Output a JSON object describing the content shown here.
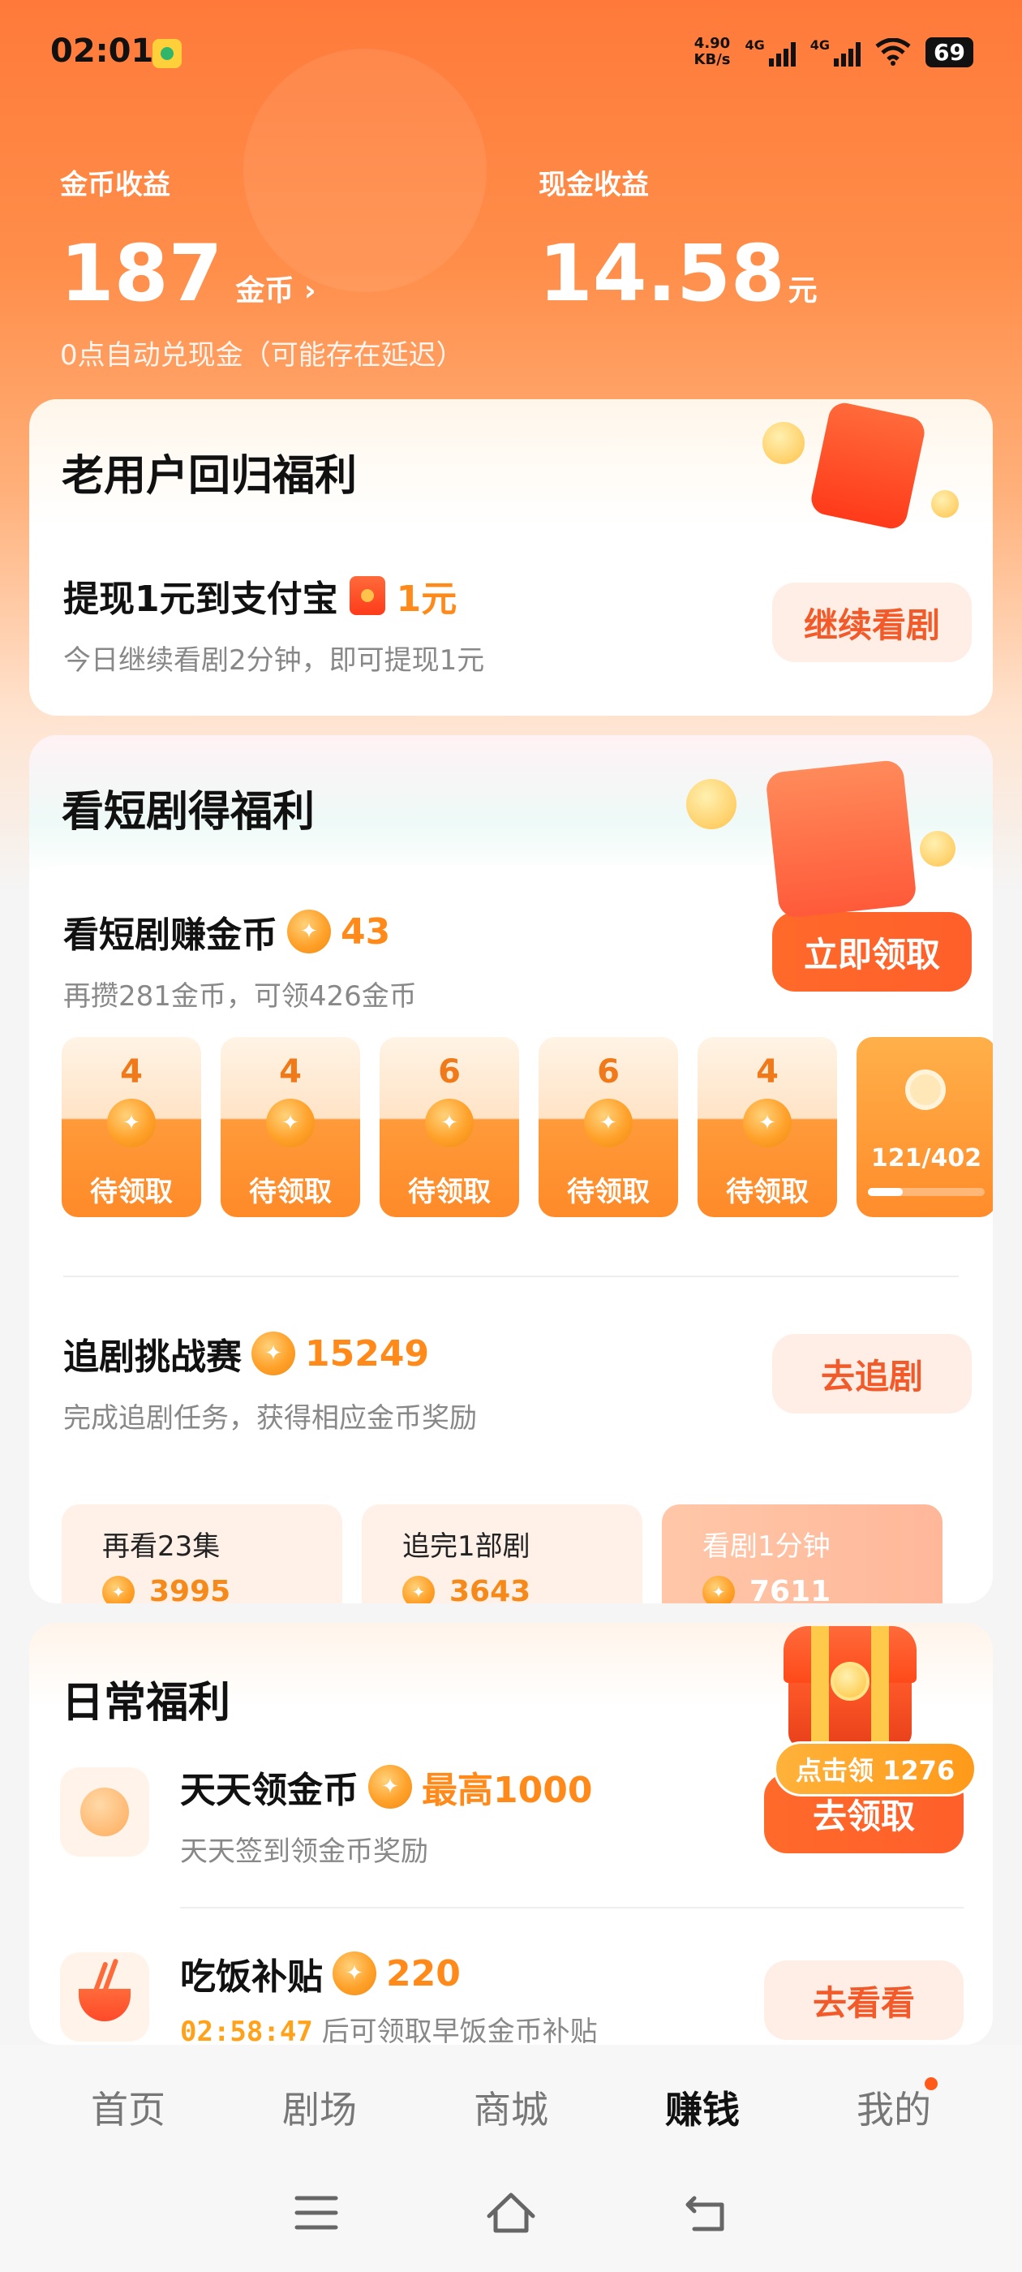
{
  "status_bar": {
    "time": "02:01",
    "speed_value": "4.90",
    "speed_unit": "KB/s",
    "signal1": "4G",
    "signal2": "4G",
    "battery": "69"
  },
  "earnings": {
    "coin_label": "金币收益",
    "coin_value": "187",
    "coin_unit": "金币 ›",
    "cash_label": "现金收益",
    "cash_value": "14.58",
    "cash_unit": "元",
    "note": "0点自动兑现金（可能存在延迟）"
  },
  "return_card": {
    "title": "老用户回归福利",
    "row_title": "提现1元到支付宝",
    "row_amount": "1元",
    "row_sub": "今日继续看剧2分钟，即可提现1元",
    "button": "继续看剧"
  },
  "drama_card": {
    "title": "看短剧得福利",
    "earn_title": "看短剧赚金币",
    "earn_coins": "43",
    "earn_sub": "再攒281金币，可领426金币",
    "earn_button": "立即领取",
    "slots": [
      {
        "value": "4",
        "label": "待领取"
      },
      {
        "value": "4",
        "label": "待领取"
      },
      {
        "value": "6",
        "label": "待领取"
      },
      {
        "value": "6",
        "label": "待领取"
      },
      {
        "value": "4",
        "label": "待领取"
      }
    ],
    "progress_text": "121/402",
    "progress_fraction": 0.3,
    "challenge_title": "追剧挑战赛",
    "challenge_coins": "15249",
    "challenge_sub": "完成追剧任务，获得相应金币奖励",
    "challenge_button": "去追剧",
    "tasks": [
      {
        "title": "再看23集",
        "value": "3995"
      },
      {
        "title": "追完1部剧",
        "value": "3643"
      },
      {
        "title": "看剧1分钟",
        "value": "7611"
      }
    ]
  },
  "daily_card": {
    "title": "日常福利",
    "bubble": "点击领 1276",
    "item1_title": "天天领金币",
    "item1_amount": "最高1000",
    "item1_sub": "天天签到领金币奖励",
    "item1_button": "去领取",
    "item2_title": "吃饭补贴",
    "item2_amount": "220",
    "item2_timer": "02:58:47",
    "item2_sub": "后可领取早饭金币补贴",
    "item2_button": "去看看"
  },
  "tabbar": {
    "tabs": [
      "首页",
      "剧场",
      "商城",
      "赚钱",
      "我的"
    ]
  }
}
